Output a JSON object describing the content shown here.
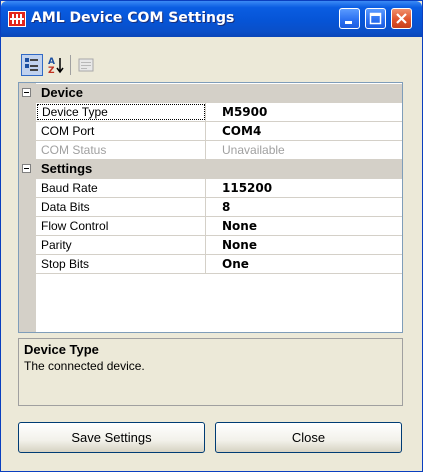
{
  "window": {
    "title": "AML Device COM Settings"
  },
  "toolbar": {
    "categorized_icon": "categorized-icon",
    "alphabetical_icon": "sort-az-icon",
    "property_pages_icon": "property-pages-icon"
  },
  "grid": {
    "categories": [
      {
        "label": "Device",
        "rows": [
          {
            "name": "Device Type",
            "value": "M5900",
            "selected": true
          },
          {
            "name": "COM Port",
            "value": "COM4"
          },
          {
            "name": "COM Status",
            "value": "Unavailable",
            "disabled": true
          }
        ]
      },
      {
        "label": "Settings",
        "rows": [
          {
            "name": "Baud Rate",
            "value": "115200"
          },
          {
            "name": "Data Bits",
            "value": "8"
          },
          {
            "name": "Flow Control",
            "value": "None"
          },
          {
            "name": "Parity",
            "value": "None"
          },
          {
            "name": "Stop Bits",
            "value": "One"
          }
        ]
      }
    ]
  },
  "description": {
    "title": "Device Type",
    "text": "The connected device."
  },
  "buttons": {
    "save": "Save Settings",
    "close": "Close"
  },
  "colors": {
    "titlebar": "#0a5de2",
    "close_button": "#e0542c",
    "category_background": "#d4d0c8",
    "window_background": "#ece9d8"
  }
}
